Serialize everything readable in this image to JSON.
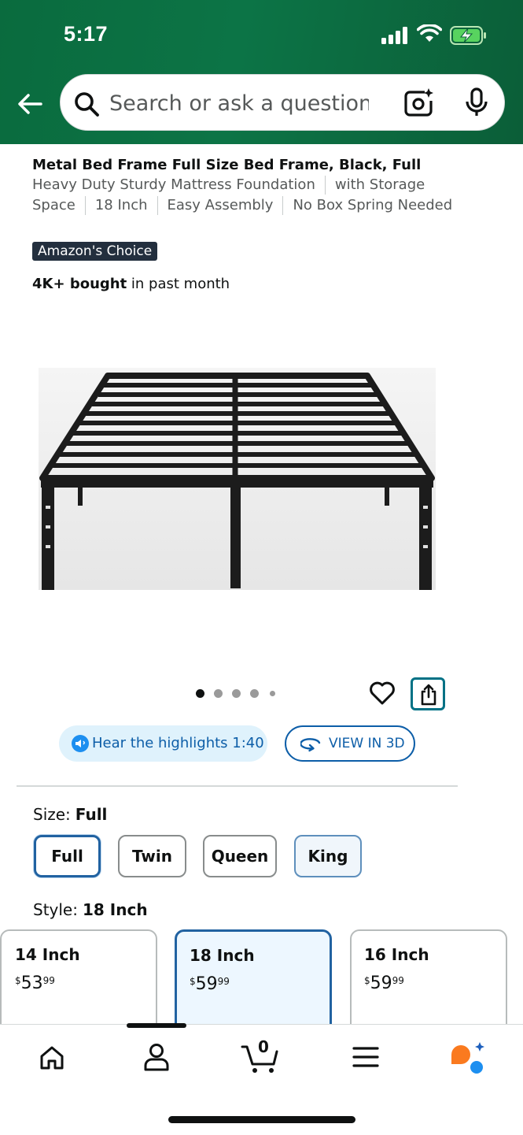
{
  "status_bar": {
    "time": "5:17"
  },
  "search": {
    "placeholder": "Search or ask a question"
  },
  "product": {
    "title": "Metal Bed Frame Full Size Bed Frame, Black, Full",
    "subtitle_parts": [
      "Heavy Duty Sturdy Mattress Foundation",
      "with Storage Space",
      "18 Inch",
      "Easy Assembly",
      "No Box Spring Needed"
    ],
    "badge": "Amazon's Choice",
    "bought_bold": "4K+ bought",
    "bought_rest": " in past month",
    "image_count": 5,
    "image_index": 1
  },
  "actions": {
    "hear_label": "Hear the highlights 1:40",
    "view3d_label": "VIEW IN 3D"
  },
  "size": {
    "label": "Size:",
    "selected": "Full",
    "options": [
      "Full",
      "Twin",
      "Queen",
      "King"
    ]
  },
  "style": {
    "label": "Style:",
    "selected": "18 Inch",
    "cards": [
      {
        "name": "14 Inch",
        "currency": "$",
        "dollars": "53",
        "cents": "99"
      },
      {
        "name": "18 Inch",
        "currency": "$",
        "dollars": "59",
        "cents": "99"
      },
      {
        "name": "16 Inch",
        "currency": "$",
        "dollars": "59",
        "cents": "99"
      }
    ]
  },
  "tabbar": {
    "cart_count": "0",
    "items": [
      "home-icon",
      "account-icon",
      "cart-icon",
      "menu-icon",
      "rufus-icon"
    ]
  },
  "colors": {
    "header_green": "#0c7446",
    "link_blue": "#0d5ea8",
    "teal": "#007185",
    "accent_orange": "#fa7a1f"
  }
}
